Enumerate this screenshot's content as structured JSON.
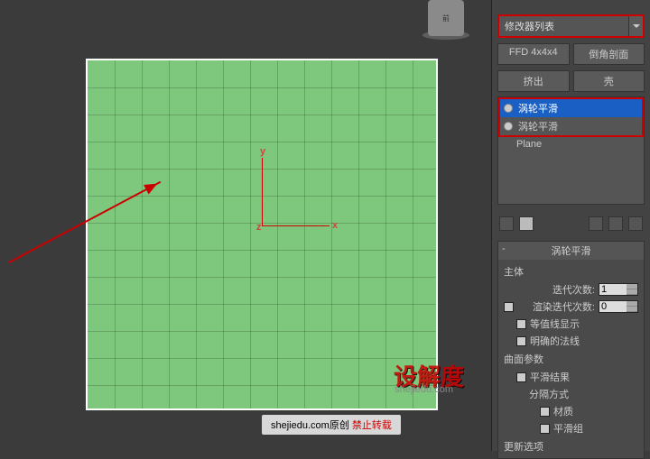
{
  "gizmo_label": "前",
  "axis": {
    "x": "x",
    "y": "y",
    "z": "z"
  },
  "watermark": {
    "big": "设解度",
    "sub": "shejiedu.com"
  },
  "credit": {
    "text": "shejiedu.com原创 ",
    "warn": "禁止转载"
  },
  "panel": {
    "modifier_list_label": "修改器列表",
    "buttons": {
      "ffd": "FFD 4x4x4",
      "chamfer": "倒角剖面",
      "extrude": "挤出",
      "shell": "壳"
    },
    "stack": {
      "items": [
        {
          "label": "涡轮平滑",
          "selected": true
        },
        {
          "label": "涡轮平滑",
          "selected": false
        }
      ],
      "base": "Plane"
    },
    "rollout": {
      "title": "涡轮平滑",
      "section_main": "主体",
      "iterations_label": "迭代次数:",
      "iterations_value": "1",
      "render_iters_label": "渲染迭代次数:",
      "render_iters_value": "0",
      "isoline_label": "等值线显示",
      "explicit_normals_label": "明确的法线",
      "section_surface": "曲面参数",
      "smooth_result_label": "平滑结果",
      "separate_label": "分隔方式",
      "material_label": "材质",
      "smooth_group_label": "平滑组",
      "section_update": "更新选项"
    }
  }
}
